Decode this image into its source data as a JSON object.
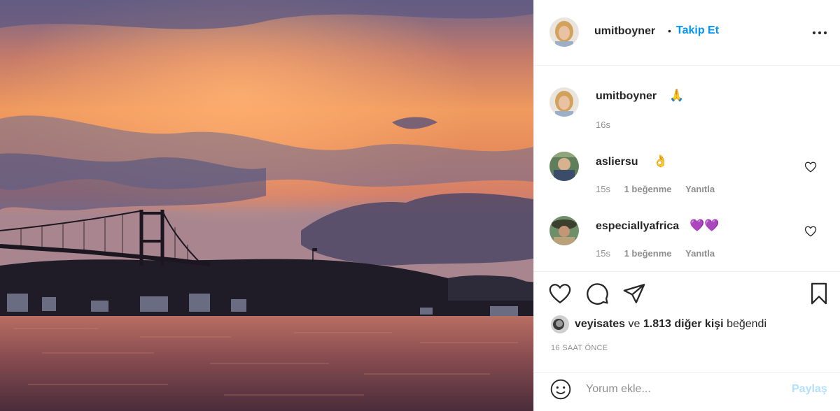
{
  "post": {
    "author": "umitboyner",
    "separator": "•",
    "follow_label": "Takip Et",
    "more_icon": "more-options-icon"
  },
  "caption": {
    "user": "umitboyner",
    "emoji": "🙏",
    "time": "16s"
  },
  "comments": [
    {
      "user": "asliersu",
      "emoji": "👌",
      "time": "15s",
      "likes": "1 beğenme",
      "reply": "Yanıtla"
    },
    {
      "user": "especiallyafrica",
      "emoji": "💜💜",
      "time": "15s",
      "likes": "1 beğenme",
      "reply": "Yanıtla"
    }
  ],
  "likes": {
    "user": "veyisates",
    "connector": "ve",
    "count": "1.813 diğer kişi",
    "suffix": "beğendi"
  },
  "timestamp": "16 SAAT ÖNCE",
  "add_comment": {
    "placeholder": "Yorum ekle...",
    "post_label": "Paylaş"
  },
  "colors": {
    "accent": "#0095f6",
    "post_disabled": "#b2dffc",
    "muted": "#8e8e8e"
  }
}
